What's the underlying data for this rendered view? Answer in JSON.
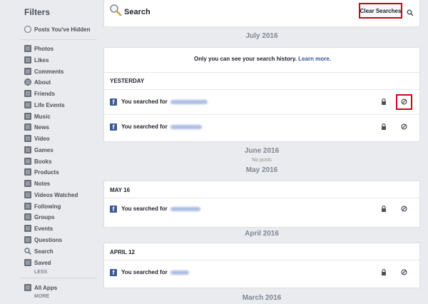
{
  "sidebar": {
    "title": "Filters",
    "hidden": "Posts You've Hidden",
    "items": [
      "Photos",
      "Likes",
      "Comments",
      "About",
      "Friends",
      "Life Events",
      "Music",
      "News",
      "Video",
      "Games",
      "Books",
      "Products",
      "Notes",
      "Videos Watched",
      "Following",
      "Groups",
      "Events",
      "Questions",
      "Search",
      "Saved"
    ],
    "less": "LESS",
    "all_apps": "All Apps",
    "more": "MORE"
  },
  "header": {
    "title": "Search",
    "clear_label": "Clear Searches"
  },
  "months": {
    "july": "July 2016",
    "june": "June 2016",
    "no_posts": "No posts",
    "may": "May 2016",
    "april": "April 2016",
    "march": "March 2016"
  },
  "privacy": {
    "text": "Only you can see your search history.",
    "link": "Learn more."
  },
  "sections": {
    "yesterday": "YESTERDAY",
    "may16": "MAY 16",
    "april12": "APRIL 12"
  },
  "rows": {
    "prefix": "You searched for"
  },
  "colors": {
    "highlight": "#d0021b",
    "fb_blue": "#3b5998",
    "link": "#365899"
  }
}
